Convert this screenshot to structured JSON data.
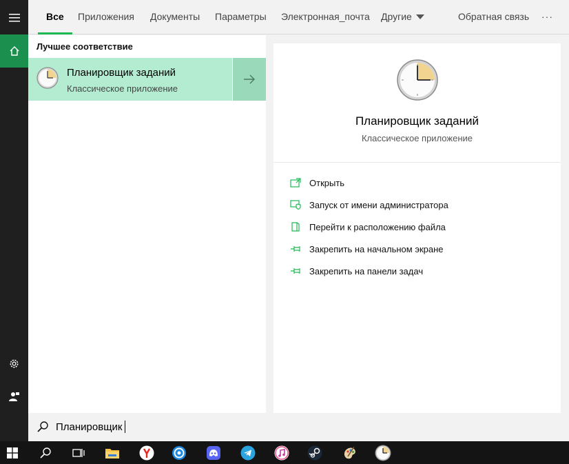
{
  "tabs": [
    {
      "label": "Все",
      "active": true
    },
    {
      "label": "Приложения"
    },
    {
      "label": "Документы"
    },
    {
      "label": "Параметры"
    },
    {
      "label": "Электронная_почта"
    },
    {
      "label": "Другие"
    },
    {
      "label": "Обратная связь"
    }
  ],
  "more_label": "···",
  "results": {
    "section_title": "Лучшее соответствие",
    "best": {
      "name_match": "Планировщик",
      "name_rest": " заданий",
      "subtitle": "Классическое приложение"
    }
  },
  "detail": {
    "title": "Планировщик заданий",
    "subtitle": "Классическое приложение",
    "actions": [
      {
        "label": "Открыть",
        "icon": "open-icon"
      },
      {
        "label": "Запуск от имени администратора",
        "icon": "shield-icon"
      },
      {
        "label": "Перейти к расположению файла",
        "icon": "file-location-icon"
      },
      {
        "label": "Закрепить на начальном экране",
        "icon": "pin-icon"
      },
      {
        "label": "Закрепить на панели задач",
        "icon": "pin-icon"
      }
    ]
  },
  "search": {
    "query": "Планировщик"
  },
  "colors": {
    "accent": "#1db954",
    "highlight": "#b3ecd1",
    "rail": "#1f1f1f",
    "rail_active": "#1a8f4e",
    "taskbar": "#141414"
  }
}
